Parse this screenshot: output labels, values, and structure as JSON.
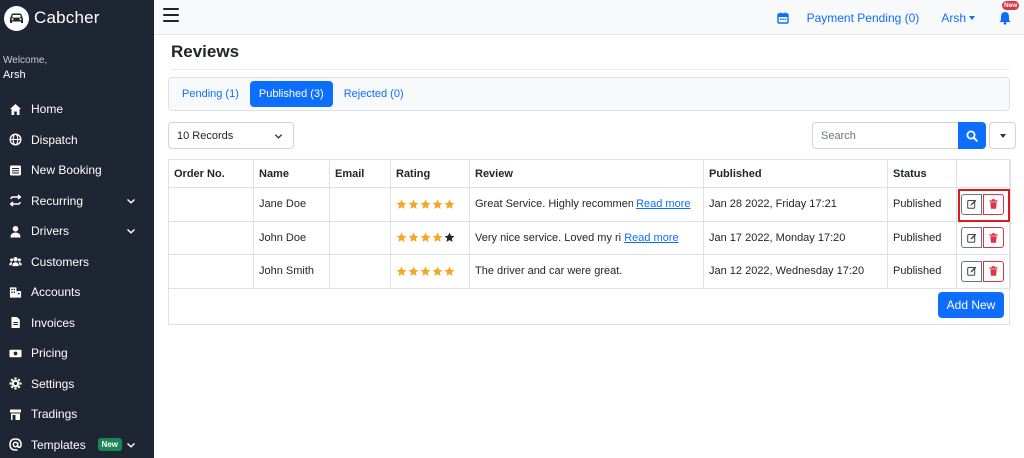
{
  "brand": {
    "name": "Cabcher"
  },
  "welcome": {
    "label": "Welcome,",
    "user": "Arsh"
  },
  "sidebar": {
    "items": [
      {
        "label": "Home",
        "icon": "home-icon"
      },
      {
        "label": "Dispatch",
        "icon": "globe-icon"
      },
      {
        "label": "New Booking",
        "icon": "list-icon"
      },
      {
        "label": "Recurring",
        "icon": "repeat-icon",
        "chevron": true
      },
      {
        "label": "Drivers",
        "icon": "user-icon",
        "chevron": true
      },
      {
        "label": "Customers",
        "icon": "users-icon"
      },
      {
        "label": "Accounts",
        "icon": "building-icon"
      },
      {
        "label": "Invoices",
        "icon": "file-icon"
      },
      {
        "label": "Pricing",
        "icon": "money-icon"
      },
      {
        "label": "Settings",
        "icon": "gear-icon"
      },
      {
        "label": "Tradings",
        "icon": "store-icon"
      },
      {
        "label": "Templates",
        "icon": "at-icon",
        "badge": "New",
        "chevron": true
      }
    ]
  },
  "topbar": {
    "payment_pending": "Payment Pending (0)",
    "user": "Arsh",
    "bell_badge": "New"
  },
  "page": {
    "title": "Reviews"
  },
  "tabs": [
    {
      "label": "Pending (1)",
      "active": false
    },
    {
      "label": "Published (3)",
      "active": true
    },
    {
      "label": "Rejected (0)",
      "active": false
    }
  ],
  "records": {
    "selected": "10 Records"
  },
  "search": {
    "placeholder": "Search"
  },
  "table": {
    "headers": [
      "Order No.",
      "Name",
      "Email",
      "Rating",
      "Review",
      "Published",
      "Status",
      ""
    ],
    "rows": [
      {
        "order": "",
        "name": "Jane Doe",
        "email": "",
        "rating": 5,
        "review": "Great Service. Highly recommen",
        "read_more": "Read more",
        "published": "Jan 28 2022, Friday 17:21",
        "status": "Published"
      },
      {
        "order": "",
        "name": "John Doe",
        "email": "",
        "rating": 4,
        "review": "Very nice service. Loved my ri",
        "read_more": "Read more",
        "published": "Jan 17 2022, Monday 17:20",
        "status": "Published"
      },
      {
        "order": "",
        "name": "John Smith",
        "email": "",
        "rating": 5,
        "review": "The driver and car were great.",
        "read_more": "",
        "published": "Jan 12 2022, Wednesday 17:20",
        "status": "Published"
      }
    ]
  },
  "actions": {
    "add_new": "Add New"
  },
  "colors": {
    "sidebar_bg": "#1f2633",
    "accent": "#0d6efd",
    "star": "#f5a623",
    "danger": "#dc3545",
    "highlight": "#e0191e"
  }
}
